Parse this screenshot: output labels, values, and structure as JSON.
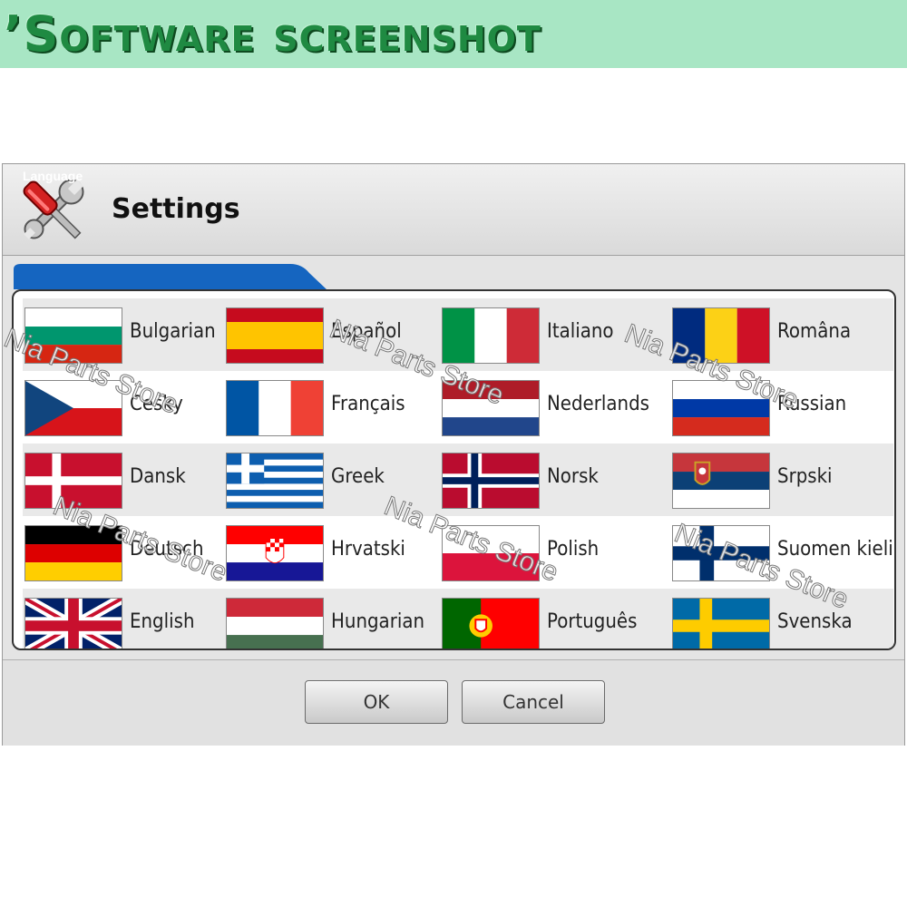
{
  "banner": {
    "text": "’Software screenshot"
  },
  "window": {
    "title": "Settings",
    "tab_label": "Language",
    "buttons": {
      "ok": "OK",
      "cancel": "Cancel"
    }
  },
  "languages": [
    {
      "label": "Bulgarian",
      "flag": "bulgaria-flag-icon"
    },
    {
      "label": "Español",
      "flag": "spain-flag-icon"
    },
    {
      "label": "Italiano",
      "flag": "italy-flag-icon"
    },
    {
      "label": "Româna",
      "flag": "romania-flag-icon"
    },
    {
      "label": "Cesky",
      "flag": "czech-flag-icon"
    },
    {
      "label": "Français",
      "flag": "france-flag-icon"
    },
    {
      "label": "Nederlands",
      "flag": "netherlands-flag-icon"
    },
    {
      "label": "Russian",
      "flag": "russia-flag-icon"
    },
    {
      "label": "Dansk",
      "flag": "denmark-flag-icon"
    },
    {
      "label": "Greek",
      "flag": "greece-flag-icon"
    },
    {
      "label": "Norsk",
      "flag": "norway-flag-icon"
    },
    {
      "label": "Srpski",
      "flag": "serbia-flag-icon"
    },
    {
      "label": "Deutsch",
      "flag": "germany-flag-icon"
    },
    {
      "label": "Hrvatski",
      "flag": "croatia-flag-icon"
    },
    {
      "label": "Polish",
      "flag": "poland-flag-icon"
    },
    {
      "label": "Suomen kieli",
      "flag": "finland-flag-icon"
    },
    {
      "label": "English",
      "flag": "uk-flag-icon"
    },
    {
      "label": "Hungarian",
      "flag": "hungary-flag-icon"
    },
    {
      "label": "Português",
      "flag": "portugal-flag-icon"
    },
    {
      "label": "Svenska",
      "flag": "sweden-flag-icon"
    }
  ],
  "watermark": {
    "text": "Nia Parts Store"
  },
  "colors": {
    "banner": "#a8e6c4",
    "tab": "#1565c0",
    "selected_row_shade": "#e9e9e9"
  }
}
